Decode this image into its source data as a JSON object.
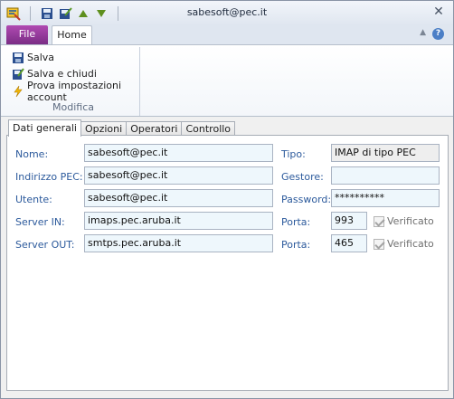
{
  "window": {
    "title": "sabesoft@pec.it"
  },
  "quick_access": {
    "icons": [
      "app-icon",
      "save-icon",
      "save-close-icon",
      "up-arrow-icon",
      "down-arrow-icon"
    ]
  },
  "ribbon": {
    "file_tab": "File",
    "home_tab": "Home",
    "items": [
      "Salva",
      "Salva e chiudi",
      "Prova impostazioni account"
    ],
    "group_label": "Modifica",
    "colors": {
      "file_tab": "#8e3a98",
      "accent_blue": "#2c5a9c"
    }
  },
  "tabs": [
    "Dati generali",
    "Opzioni",
    "Operatori",
    "Controllo"
  ],
  "form": {
    "nome_label": "Nome:",
    "nome_value": "sabesoft@pec.it",
    "indirizzo_label": "Indirizzo PEC:",
    "indirizzo_value": "sabesoft@pec.it",
    "utente_label": "Utente:",
    "utente_value": "sabesoft@pec.it",
    "server_in_label": "Server IN:",
    "server_in_value": "imaps.pec.aruba.it",
    "server_out_label": "Server OUT:",
    "server_out_value": "smtps.pec.aruba.it",
    "tipo_label": "Tipo:",
    "tipo_value": "IMAP di tipo PEC",
    "gestore_label": "Gestore:",
    "gestore_value": "",
    "password_label": "Password:",
    "password_value": "**********",
    "porta_in_label": "Porta:",
    "porta_in_value": "993",
    "porta_out_label": "Porta:",
    "porta_out_value": "465",
    "verificato_in_label": "Verificato",
    "verificato_out_label": "Verificato"
  }
}
